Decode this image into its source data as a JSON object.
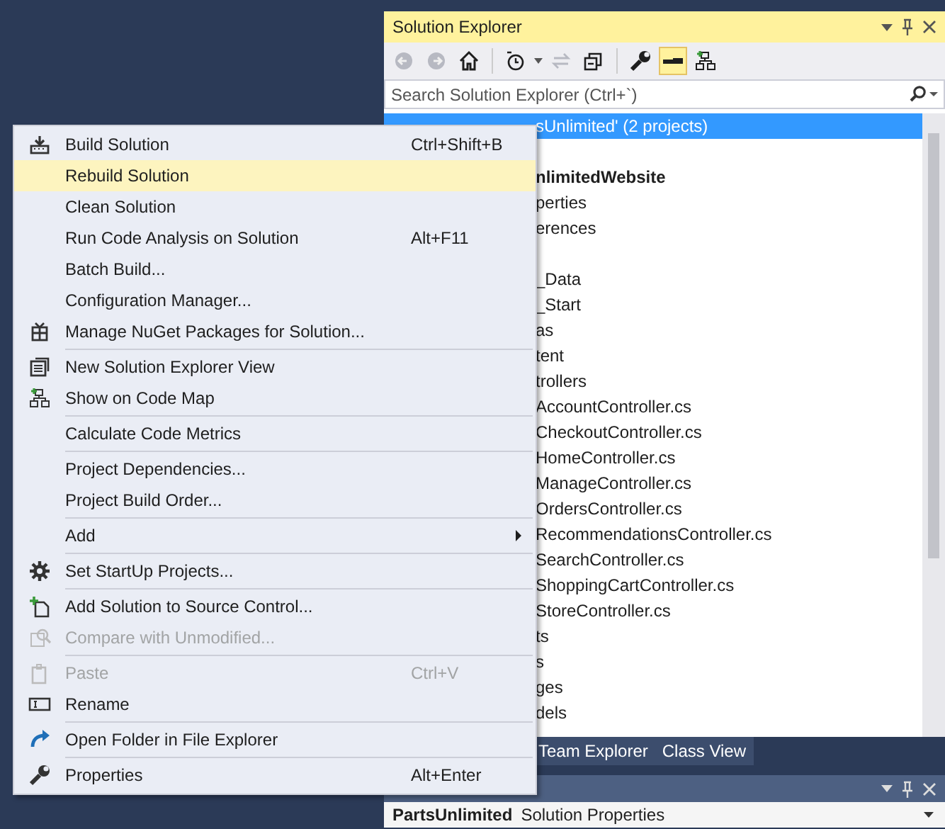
{
  "solution_explorer": {
    "title": "Solution Explorer",
    "toolbar": [
      {
        "disabled": true,
        "selected": false
      },
      {
        "disabled": true,
        "selected": false
      },
      {
        "disabled": false,
        "selected": false
      },
      {
        "disabled": false,
        "selected": false
      },
      {
        "disabled": true,
        "selected": false
      },
      {
        "disabled": false,
        "selected": false
      },
      {
        "disabled": false,
        "selected": false
      },
      {
        "disabled": false,
        "selected": true
      },
      {
        "disabled": false,
        "selected": false
      }
    ],
    "search": {
      "placeholder": "Search Solution Explorer (Ctrl+`)"
    },
    "tree": [
      {
        "label": "sUnlimited' (2 projects)",
        "selected": true,
        "bold": false
      },
      {
        "selected": false
      },
      {
        "label": "nlimitedWebsite",
        "selected": false,
        "bold": true
      },
      {
        "label": "perties",
        "selected": false,
        "bold": false
      },
      {
        "label": "erences",
        "selected": false,
        "bold": false
      },
      {
        "selected": false
      },
      {
        "label": "_Data",
        "selected": false,
        "bold": false
      },
      {
        "label": "_Start",
        "selected": false,
        "bold": false
      },
      {
        "label": "as",
        "selected": false,
        "bold": false
      },
      {
        "label": "tent",
        "selected": false,
        "bold": false
      },
      {
        "label": "trollers",
        "selected": false,
        "bold": false
      },
      {
        "label": "AccountController.cs",
        "selected": false,
        "bold": false
      },
      {
        "label": "CheckoutController.cs",
        "selected": false,
        "bold": false
      },
      {
        "label": "HomeController.cs",
        "selected": false,
        "bold": false
      },
      {
        "label": "ManageController.cs",
        "selected": false,
        "bold": false
      },
      {
        "label": "OrdersController.cs",
        "selected": false,
        "bold": false
      },
      {
        "label": "RecommendationsController.cs",
        "selected": false,
        "bold": false
      },
      {
        "label": "SearchController.cs",
        "selected": false,
        "bold": false
      },
      {
        "label": "ShoppingCartController.cs",
        "selected": false,
        "bold": false
      },
      {
        "label": "StoreController.cs",
        "selected": false,
        "bold": false
      },
      {
        "label": "ts",
        "selected": false,
        "bold": false
      },
      {
        "label": "s",
        "selected": false,
        "bold": false
      },
      {
        "label": "ges",
        "selected": false,
        "bold": false
      },
      {
        "label": "dels",
        "selected": false,
        "bold": false
      }
    ],
    "tabs": [
      {
        "label": "Team Explorer",
        "selected": false
      },
      {
        "label": "Class View",
        "selected": false
      }
    ]
  },
  "properties": {
    "object": "PartsUnlimited",
    "type": "Solution Properties"
  },
  "context_menu": [
    {
      "kind": "item",
      "label": "Build Solution",
      "shortcut": "Ctrl+Shift+B",
      "selected": false,
      "disabled": false,
      "submenu": false
    },
    {
      "kind": "item",
      "label": "Rebuild Solution",
      "selected": true,
      "disabled": false,
      "submenu": false
    },
    {
      "kind": "item",
      "label": "Clean Solution",
      "selected": false,
      "disabled": false,
      "submenu": false
    },
    {
      "kind": "item",
      "label": "Run Code Analysis on Solution",
      "shortcut": "Alt+F11",
      "selected": false,
      "disabled": false,
      "submenu": false
    },
    {
      "kind": "item",
      "label": "Batch Build...",
      "selected": false,
      "disabled": false,
      "submenu": false
    },
    {
      "kind": "item",
      "label": "Configuration Manager...",
      "selected": false,
      "disabled": false,
      "submenu": false
    },
    {
      "kind": "item",
      "label": "Manage NuGet Packages for Solution...",
      "selected": false,
      "disabled": false,
      "submenu": false
    },
    {
      "kind": "separator"
    },
    {
      "kind": "item",
      "label": "New Solution Explorer View",
      "selected": false,
      "disabled": false,
      "submenu": false
    },
    {
      "kind": "item",
      "label": "Show on Code Map",
      "selected": false,
      "disabled": false,
      "submenu": false
    },
    {
      "kind": "separator"
    },
    {
      "kind": "item",
      "label": "Calculate Code Metrics",
      "selected": false,
      "disabled": false,
      "submenu": false
    },
    {
      "kind": "separator"
    },
    {
      "kind": "item",
      "label": "Project Dependencies...",
      "selected": false,
      "disabled": false,
      "submenu": false
    },
    {
      "kind": "item",
      "label": "Project Build Order...",
      "selected": false,
      "disabled": false,
      "submenu": false
    },
    {
      "kind": "separator"
    },
    {
      "kind": "item",
      "label": "Add",
      "selected": false,
      "disabled": false,
      "submenu": true
    },
    {
      "kind": "separator"
    },
    {
      "kind": "item",
      "label": "Set StartUp Projects...",
      "selected": false,
      "disabled": false,
      "submenu": false
    },
    {
      "kind": "separator"
    },
    {
      "kind": "item",
      "label": "Add Solution to Source Control...",
      "selected": false,
      "disabled": false,
      "submenu": false
    },
    {
      "kind": "item",
      "label": "Compare with Unmodified...",
      "selected": false,
      "disabled": true,
      "submenu": false
    },
    {
      "kind": "separator"
    },
    {
      "kind": "item",
      "label": "Paste",
      "shortcut": "Ctrl+V",
      "selected": false,
      "disabled": true,
      "submenu": false
    },
    {
      "kind": "item",
      "label": "Rename",
      "selected": false,
      "disabled": false,
      "submenu": false
    },
    {
      "kind": "separator"
    },
    {
      "kind": "item",
      "label": "Open Folder in File Explorer",
      "selected": false,
      "disabled": false,
      "submenu": false
    },
    {
      "kind": "separator"
    },
    {
      "kind": "item",
      "label": "Properties",
      "shortcut": "Alt+Enter",
      "selected": false,
      "disabled": false,
      "submenu": false
    }
  ]
}
